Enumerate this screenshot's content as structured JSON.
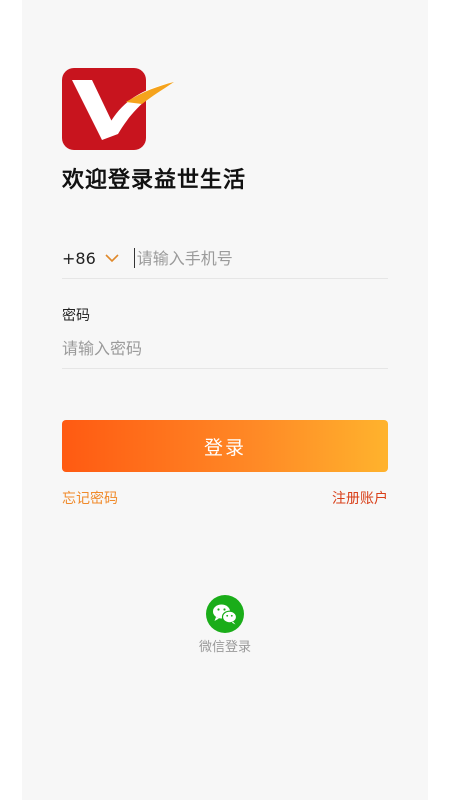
{
  "app": {
    "welcome": "欢迎登录益世生活",
    "logo_color": "#c8141e"
  },
  "login": {
    "country_code": "+86",
    "phone_placeholder": "请输入手机号",
    "password_label": "密码",
    "password_placeholder": "请输入密码",
    "submit_label": "登录",
    "accent_start": "#ff5a12",
    "accent_end": "#ffb32d"
  },
  "links": {
    "forgot_password": "忘记密码",
    "register": "注册账户"
  },
  "social": {
    "wechat_label": "微信登录",
    "wechat_color": "#1aad19"
  }
}
